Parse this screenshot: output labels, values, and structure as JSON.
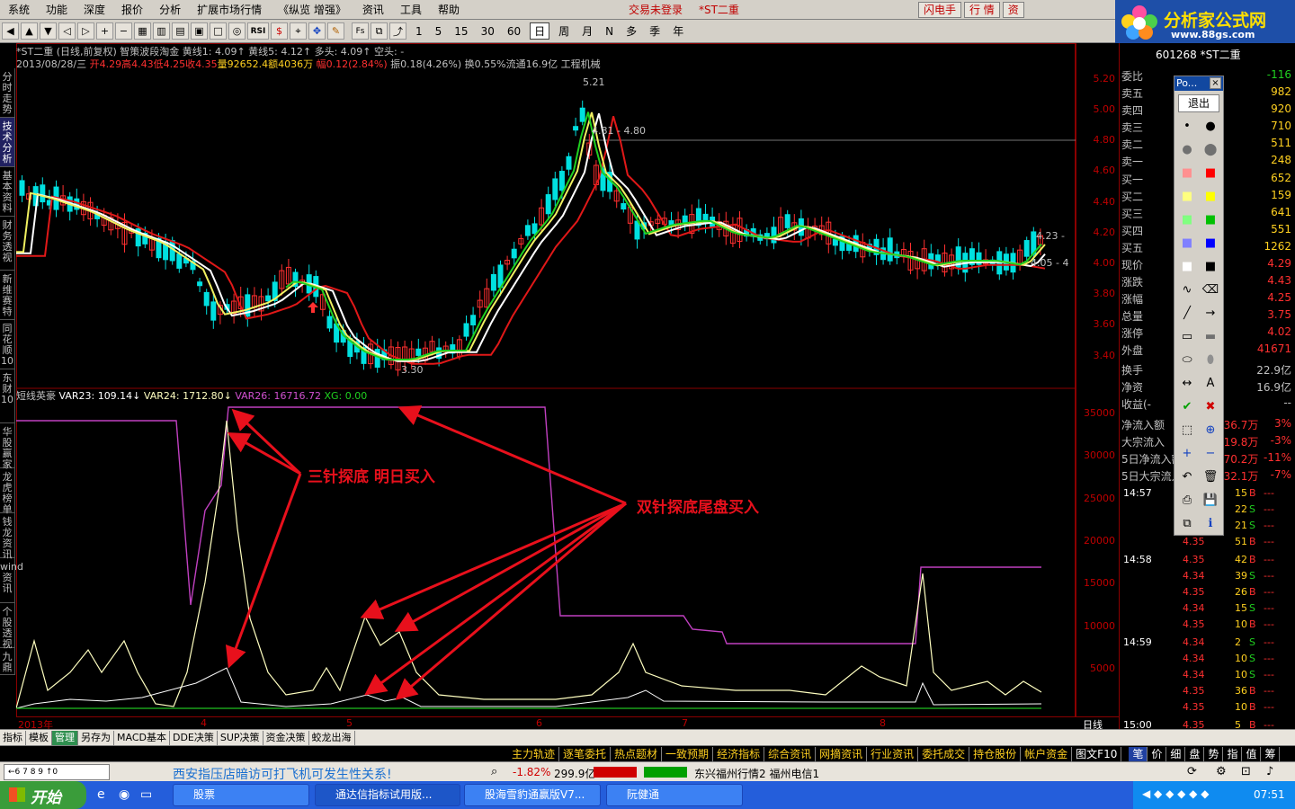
{
  "menu": {
    "items": [
      "系统",
      "功能",
      "深度",
      "报价",
      "分析",
      "扩展市场行情",
      "《纵览 增强》",
      "资讯",
      "工具",
      "帮助"
    ],
    "status": "交易未登录",
    "stock_tag": "*ST二重",
    "btn_flash": "闪电手",
    "btn_quote": "行 情",
    "btn_asset": "资"
  },
  "toolbar": {
    "periods": [
      "1",
      "5",
      "15",
      "30",
      "60",
      "日",
      "周",
      "月",
      "N",
      "多",
      "季",
      "年"
    ],
    "active_period": "日"
  },
  "logo": {
    "title": "分析家公式网",
    "url": "www.88gs.com"
  },
  "left_tabs": [
    "分时走势",
    "技术分析",
    "基本资料",
    "财务透视",
    "新维赛特",
    "同花顺10",
    "东财10",
    "华股赢家",
    "龙虎榜单",
    "钱龙资讯",
    "wind资讯",
    "个股透视",
    "九鼎"
  ],
  "active_left_tab": "技术分析",
  "chart_header": {
    "line1": "*ST二重 (日线,前复权) 智策波段淘金 黄线1: 4.09↑ 黄线5: 4.12↑ 多头: 4.09↑ 空头: -",
    "line2_prefix": "2013/08/28/三",
    "line2_open": "开4.29",
    "line2_high": "高4.43",
    "line2_low": "低4.25",
    "line2_close": "收4.35",
    "line2_vol": "量92652.4",
    "line2_amt": "额4036万",
    "line2_pct": "幅0.12(2.84%)",
    "line2_amp": "振0.18(4.26%)",
    "line2_turn": "换0.55%",
    "line2_float": "流通16.9亿",
    "line2_ind": "工程机械"
  },
  "indicator_header": {
    "name": "短线英豪",
    "var23": "VAR23: 109.14↓",
    "var24": "VAR24: 1712.80↓",
    "var26": "VAR26: 16716.72",
    "xg": "XG: 0.00"
  },
  "price_axis": [
    "5.20",
    "5.00",
    "4.80",
    "4.60",
    "4.40",
    "4.20",
    "4.00",
    "3.80",
    "3.60",
    "3.40"
  ],
  "ind_axis": [
    "35000",
    "30000",
    "25000",
    "20000",
    "15000",
    "10000",
    "5000"
  ],
  "price_labels": {
    "high": "5.21",
    "mid": "4.81 - 4.80",
    "low": "3.30",
    "right1": "4.23 -",
    "right2": "4.05 - 4"
  },
  "x_axis": {
    "labels": [
      "2013年",
      "4",
      "5",
      "6",
      "7",
      "8"
    ],
    "right": "日线"
  },
  "annotations": {
    "a1": "三针探底 明日买入",
    "a2": "双针探底尾盘买入"
  },
  "right_panel": {
    "code": "601268 *ST二重",
    "weibi_label": "委比",
    "weibi_val": "-116",
    "asks": [
      [
        "卖五",
        "982"
      ],
      [
        "卖四",
        "920"
      ],
      [
        "卖三",
        "710"
      ],
      [
        "卖二",
        "511"
      ],
      [
        "卖一",
        "248"
      ]
    ],
    "bids": [
      [
        "买一",
        "652"
      ],
      [
        "买二",
        "159"
      ],
      [
        "买三",
        "641"
      ],
      [
        "买四",
        "551"
      ],
      [
        "买五",
        "1262"
      ]
    ],
    "stats": [
      [
        "现价",
        "4.29"
      ],
      [
        "涨跌",
        "4.43"
      ],
      [
        "涨幅",
        "4.25"
      ],
      [
        "总量",
        "3.75"
      ],
      [
        "涨停",
        "4.02"
      ],
      [
        "外盘",
        "41671"
      ]
    ],
    "stats2": [
      [
        "换手",
        "22.9亿"
      ],
      [
        "净资",
        "16.9亿"
      ],
      [
        "收益(-",
        "--"
      ]
    ],
    "flows": [
      [
        "净流入额",
        "136.7万",
        "3%"
      ],
      [
        "大宗流入",
        "119.8万",
        "-3%"
      ],
      [
        "5日净流入额",
        "070.2万",
        "-11%"
      ],
      [
        "5日大宗流入",
        "632.1万",
        "-7%"
      ]
    ],
    "ticks": [
      [
        "14:57",
        "",
        "15",
        "B",
        "---"
      ],
      [
        "",
        "",
        "22",
        "S",
        "---"
      ],
      [
        "",
        "",
        "21",
        "S",
        "---"
      ],
      [
        "",
        "4.35",
        "51",
        "B",
        "---"
      ],
      [
        "14:58",
        "4.35",
        "42",
        "B",
        "---"
      ],
      [
        "",
        "4.34",
        "39",
        "S",
        "---"
      ],
      [
        "",
        "4.35",
        "26",
        "B",
        "---"
      ],
      [
        "",
        "4.34",
        "15",
        "S",
        "---"
      ],
      [
        "",
        "4.35",
        "10",
        "B",
        "---"
      ],
      [
        "14:59",
        "4.34",
        "2",
        "S",
        "---"
      ],
      [
        "",
        "4.34",
        "10",
        "S",
        "---"
      ],
      [
        "",
        "4.34",
        "10",
        "S",
        "---"
      ],
      [
        "",
        "4.35",
        "36",
        "B",
        "---"
      ],
      [
        "",
        "4.35",
        "10",
        "B",
        "---"
      ],
      [
        "15:00",
        "4.35",
        "5",
        "B",
        "---"
      ]
    ]
  },
  "popup": {
    "title": "Po...",
    "exit": "退出"
  },
  "tabs1": [
    "指标",
    "模板",
    "管理",
    "另存为",
    "MACD基本",
    "DDE决策",
    "SUP决策",
    "资金决策",
    "蛟龙出海"
  ],
  "active_tab1": "管理",
  "tabs2": [
    "主力轨迹",
    "逐笔委托",
    "热点题材",
    "一致预期",
    "经济指标",
    "综合资讯",
    "网摘资讯",
    "行业资讯",
    "委托成交",
    "持仓股份",
    "帐户资金",
    "图文F10"
  ],
  "tabs2_right": [
    "笔",
    "价",
    "细",
    "盘",
    "势",
    "指",
    "值",
    "筹"
  ],
  "status": {
    "ticker": "西安指压店暗访可打飞机可发生性关系!",
    "pct": "-1.82%",
    "amount": "299.9亿",
    "news": "东兴福州行情2 福州电信1"
  },
  "taskbar": {
    "start": "开始",
    "items": [
      "股票",
      "通达信指标试用版...",
      "股海雪豹通赢版V7...",
      "阮健通"
    ],
    "clock": "07:51"
  },
  "colors": {
    "up": "#ff3030",
    "down": "#00e0e0",
    "bg": "#000000",
    "axis": "#c00000"
  }
}
